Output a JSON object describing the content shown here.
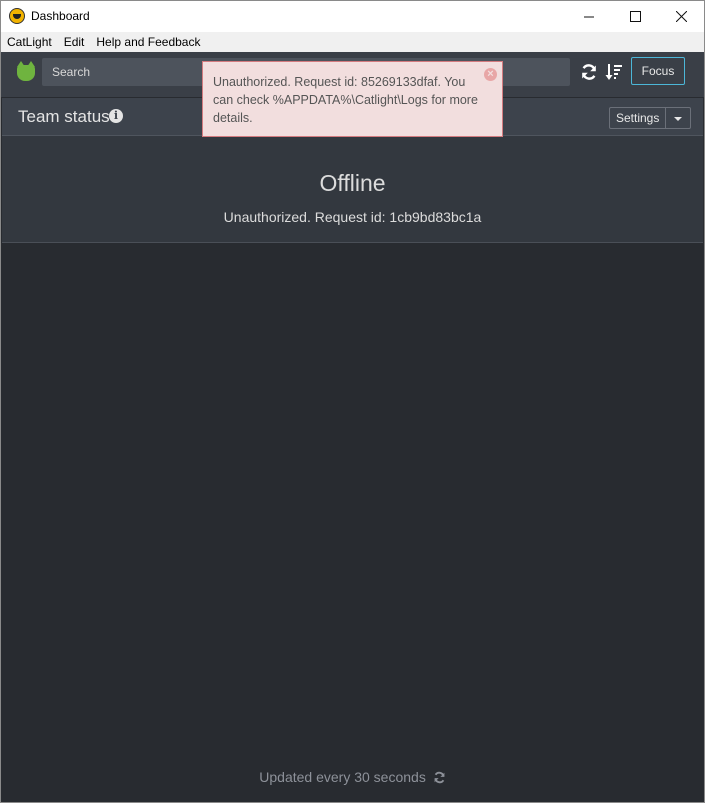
{
  "window": {
    "title": "Dashboard",
    "controls": {
      "minimize": "—",
      "maximize": "☐",
      "close": "✕"
    }
  },
  "menu": {
    "items": [
      "CatLight",
      "Edit",
      "Help and Feedback"
    ]
  },
  "toolbar": {
    "search_placeholder": "Search",
    "focus_label": "Focus"
  },
  "panel": {
    "title": "Team status",
    "info_glyph": "i",
    "settings_label": "Settings"
  },
  "status": {
    "title": "Offline",
    "message": "Unauthorized. Request id: 1cb9bd83bc1a"
  },
  "footer": {
    "text": "Updated every 30 seconds"
  },
  "toast": {
    "message": "Unauthorized. Request id: 85269133dfaf. You can check %APPDATA%\\Catlight\\Logs for more details.",
    "close_glyph": "×"
  },
  "colors": {
    "background": "#282b30",
    "toolbar": "#3a3f47",
    "accent": "#4cb7d8",
    "cat_logo": "#6fb43f",
    "toast_bg": "#f2dede",
    "toast_border": "#d47b7f"
  }
}
